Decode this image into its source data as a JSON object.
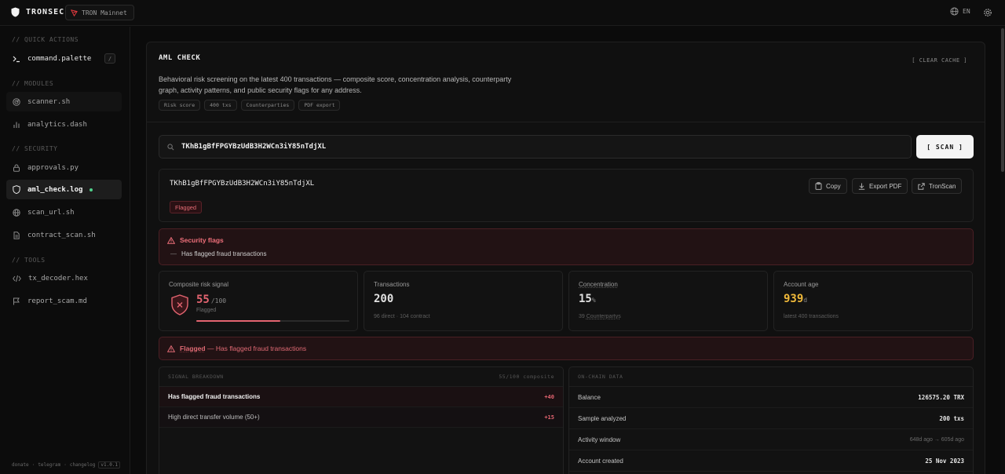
{
  "app": {
    "brand": "TRONSEC",
    "network": "TRON Mainnet",
    "language": "EN"
  },
  "sidebar": {
    "sections": [
      {
        "title": "// QUICK ACTIONS"
      },
      {
        "title": "// MODULES"
      },
      {
        "title": "// SECURITY"
      },
      {
        "title": "// TOOLS"
      }
    ],
    "items": [
      {
        "label": "command.palette",
        "shortcut": "/"
      },
      {
        "label": "scanner.sh"
      },
      {
        "label": "analytics.dash"
      },
      {
        "label": "approvals.py"
      },
      {
        "label": "aml_check.log"
      },
      {
        "label": "scan_url.sh"
      },
      {
        "label": "contract_scan.sh"
      },
      {
        "label": "tx_decoder.hex"
      },
      {
        "label": "report_scam.md"
      }
    ],
    "footer": {
      "donate": "donate",
      "sep": "·",
      "telegram": "telegram",
      "changelog": "changelog",
      "version": "v1.0.1"
    }
  },
  "main": {
    "title": "AML CHECK",
    "clear_cache": "[ CLEAR CACHE ]",
    "description": "Behavioral risk screening on the latest 400 transactions — composite score, concentration analysis, counterparty graph, activity patterns, and public security flags for any address.",
    "tags": [
      "Risk score",
      "400 txs",
      "Counterparties",
      "PDF export"
    ],
    "search": {
      "value": "TKhB1gBfFPGYBzUdB3H2WCn3iY85nTdjXL"
    },
    "scan_button": "[ SCAN ]",
    "address": {
      "value": "TKhB1gBfFPGYBzUdB3H2WCn3iY85nTdjXL",
      "badge": "Flagged",
      "actions": {
        "copy": "Copy",
        "export": "Export PDF",
        "tronscan": "TronScan"
      }
    },
    "security_flags": {
      "title": "Security flags",
      "items": [
        "Has flagged fraud transactions"
      ],
      "bullet": "—"
    },
    "stats": {
      "risk": {
        "label": "Composite risk signal",
        "score": "55",
        "max": "/100",
        "status": "Flagged",
        "progress": 0.55
      },
      "transactions": {
        "label": "Transactions",
        "value": "200",
        "sub": "96 direct · 104 contract"
      },
      "concentration": {
        "label": "Concentration",
        "value": "15",
        "unit": "%",
        "sub_count": "39",
        "sub_label": "Counterpartys"
      },
      "age": {
        "label": "Account age",
        "value": "939",
        "unit": "d",
        "sub": "latest 400 transactions"
      }
    },
    "banner": {
      "strong": "Flagged",
      "text": " — Has flagged fraud transactions"
    },
    "signal_breakdown": {
      "title": "SIGNAL BREAKDOWN",
      "composite": "55/100 composite",
      "rows": [
        {
          "label": "Has flagged fraud transactions",
          "points": "+40"
        },
        {
          "label": "High direct transfer volume (50+)",
          "points": "+15"
        }
      ]
    },
    "onchain": {
      "title": "ON-CHAIN DATA",
      "rows": [
        {
          "label": "Balance",
          "value": "126575.20 TRX"
        },
        {
          "label": "Sample analyzed",
          "value": "200 txs"
        },
        {
          "label": "Activity window",
          "value": "648d ago → 605d ago"
        },
        {
          "label": "Account created",
          "value": "25 Nov 2023"
        }
      ]
    }
  },
  "colors": {
    "accent_red": "#e36470",
    "age_yellow": "#f0b93a",
    "badge_bg": "#2a1114"
  }
}
